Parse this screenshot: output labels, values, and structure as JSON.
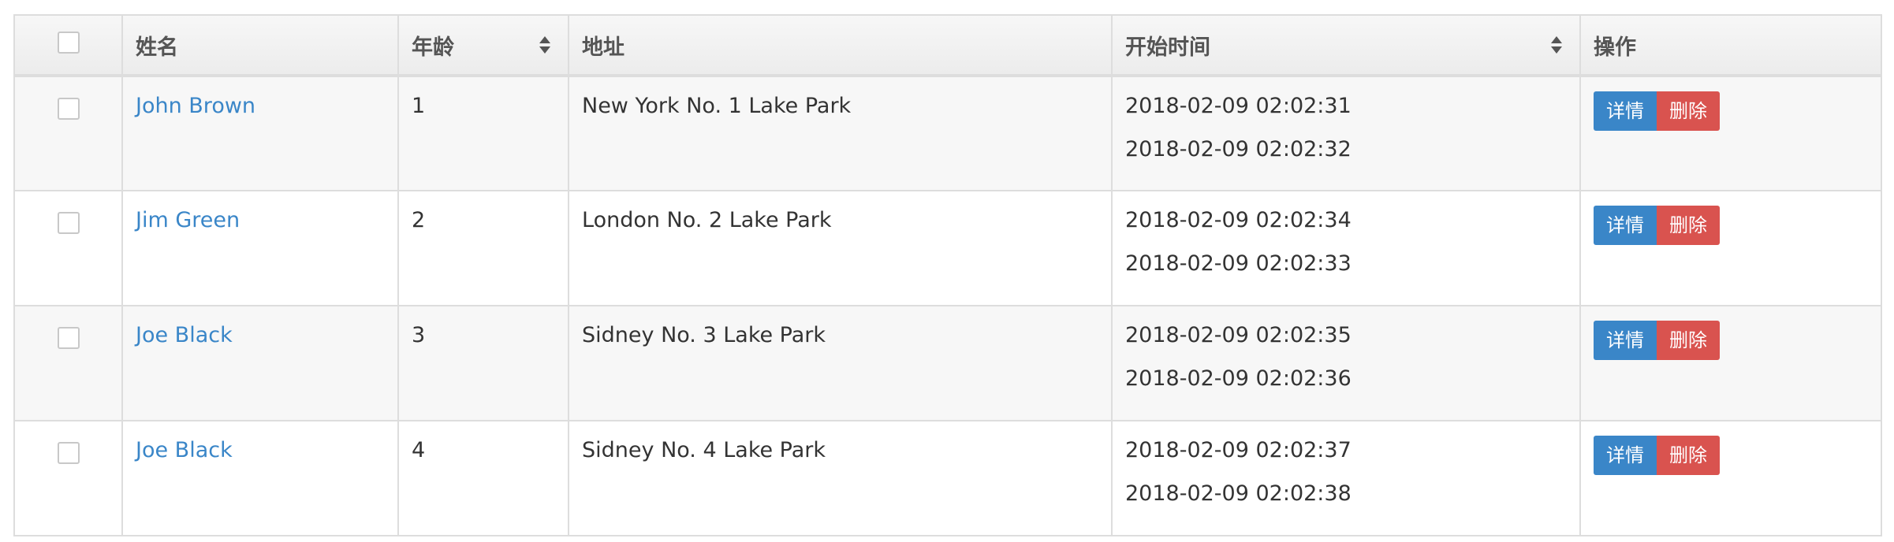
{
  "columns": {
    "name": "姓名",
    "age": "年龄",
    "address": "地址",
    "start_time": "开始时间",
    "actions": "操作"
  },
  "rows": [
    {
      "name": "John Brown",
      "age": "1",
      "address": "New York No. 1 Lake Park",
      "times": [
        "2018-02-09 02:02:31",
        "2018-02-09 02:02:32"
      ],
      "detail_label": "详情",
      "delete_label": "删除"
    },
    {
      "name": "Jim Green",
      "age": "2",
      "address": "London No. 2 Lake Park",
      "times": [
        "2018-02-09 02:02:34",
        "2018-02-09 02:02:33"
      ],
      "detail_label": "详情",
      "delete_label": "删除"
    },
    {
      "name": "Joe Black",
      "age": "3",
      "address": "Sidney No. 3 Lake Park",
      "times": [
        "2018-02-09 02:02:35",
        "2018-02-09 02:02:36"
      ],
      "detail_label": "详情",
      "delete_label": "删除"
    },
    {
      "name": "Joe Black",
      "age": "4",
      "address": "Sidney No. 4 Lake Park",
      "times": [
        "2018-02-09 02:02:37",
        "2018-02-09 02:02:38"
      ],
      "detail_label": "详情",
      "delete_label": "删除"
    }
  ],
  "icons": {
    "sort": "sort-icon"
  },
  "colors": {
    "link": "#3a86c8",
    "detail_button": "#3a86c8",
    "delete_button": "#d9534f",
    "header_bg": "#f0f0f0",
    "stripe_bg": "#f7f7f7",
    "border": "#dddddd"
  }
}
